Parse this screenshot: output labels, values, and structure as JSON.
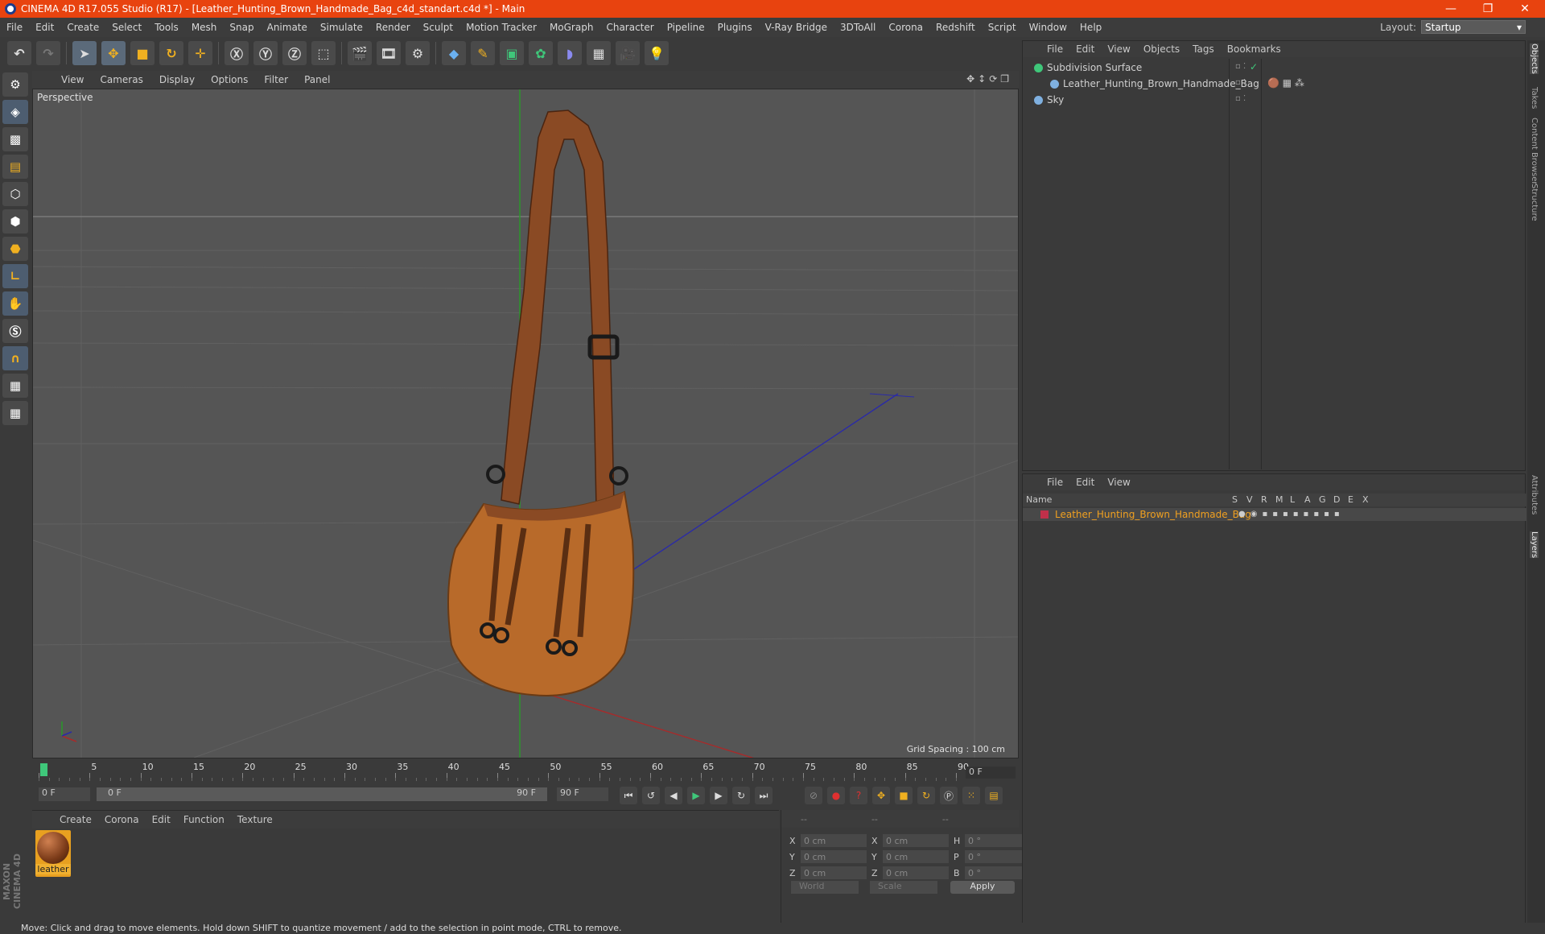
{
  "window": {
    "title": "CINEMA 4D R17.055 Studio (R17) - [Leather_Hunting_Brown_Handmade_Bag_c4d_standart.c4d *] - Main",
    "controls": [
      "—",
      "❐",
      "✕"
    ]
  },
  "menubar": {
    "items": [
      "File",
      "Edit",
      "Create",
      "Select",
      "Tools",
      "Mesh",
      "Snap",
      "Animate",
      "Simulate",
      "Render",
      "Sculpt",
      "Motion Tracker",
      "MoGraph",
      "Character",
      "Pipeline",
      "Plugins",
      "V-Ray Bridge",
      "3DToAll",
      "Corona",
      "Redshift",
      "Script",
      "Window",
      "Help"
    ],
    "layout_label": "Layout:",
    "layout_value": "Startup"
  },
  "viewport": {
    "menu": [
      "View",
      "Cameras",
      "Display",
      "Options",
      "Filter",
      "Panel"
    ],
    "label": "Perspective",
    "grid_spacing": "Grid Spacing : 100 cm",
    "colors": {
      "background": "#555555",
      "bag": "#b86a2a",
      "strap": "#8a4a24",
      "y_axis": "#2a9a2a",
      "z_axis": "#2a2aa8",
      "x_axis": "#a82a2a"
    }
  },
  "timeline": {
    "ticks": [
      "0",
      "5",
      "10",
      "15",
      "20",
      "25",
      "30",
      "35",
      "40",
      "45",
      "50",
      "55",
      "60",
      "65",
      "70",
      "75",
      "80",
      "85",
      "90"
    ],
    "current_frame": "0 F",
    "start_field": "0 F",
    "range_start": "0 F",
    "range_end": "90 F",
    "end_field": "90 F"
  },
  "material_panel": {
    "menu": [
      "Create",
      "Corona",
      "Edit",
      "Function",
      "Texture"
    ],
    "materials": [
      {
        "name": "leather"
      }
    ]
  },
  "coordinates": {
    "header": [
      "--",
      "--",
      "--"
    ],
    "rows": [
      {
        "a": "X",
        "av": "0 cm",
        "b": "X",
        "bv": "0 cm",
        "c": "H",
        "cv": "0 °"
      },
      {
        "a": "Y",
        "av": "0 cm",
        "b": "Y",
        "bv": "0 cm",
        "c": "P",
        "cv": "0 °"
      },
      {
        "a": "Z",
        "av": "0 cm",
        "b": "Z",
        "bv": "0 cm",
        "c": "B",
        "cv": "0 °"
      }
    ],
    "space": "World",
    "mode": "Scale",
    "apply": "Apply"
  },
  "object_manager": {
    "menu": [
      "File",
      "Edit",
      "View",
      "Objects",
      "Tags",
      "Bookmarks"
    ],
    "objects": [
      {
        "name": "Subdivision Surface",
        "icon": "subdivision-icon",
        "color": "#3fc77a"
      },
      {
        "name": "Leather_Hunting_Brown_Handmade_Bag",
        "icon": "polygon-icon",
        "color": "#7fb0e0"
      },
      {
        "name": "Sky",
        "icon": "sky-icon",
        "color": "#7fb0e0"
      }
    ]
  },
  "layer_manager": {
    "menu": [
      "File",
      "Edit",
      "View"
    ],
    "columns": [
      "Name",
      "S",
      "V",
      "R",
      "M",
      "L",
      "A",
      "G",
      "D",
      "E",
      "X"
    ],
    "layers": [
      {
        "name": "Leather_Hunting_Brown_Handmade_Bag",
        "color": "#c0304a"
      }
    ]
  },
  "right_tabs": [
    "Objects",
    "Takes",
    "Content Browser",
    "Structure",
    "Attributes",
    "Layers"
  ],
  "status": "Move: Click and drag to move elements. Hold down SHIFT to quantize movement / add to the selection in point mode, CTRL to remove.",
  "brand": "MAXON CINEMA 4D",
  "accent_color": "#e8430f"
}
